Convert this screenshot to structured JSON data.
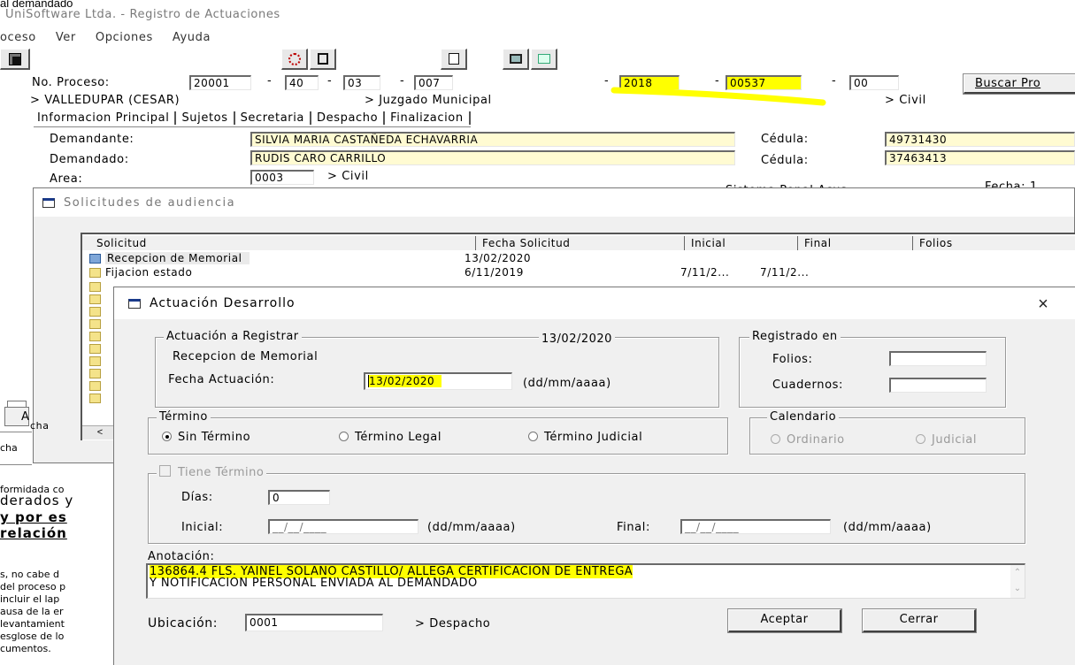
{
  "top_clip": "al demandado",
  "main_window": {
    "title": "UniSoftware Ltda. - Registro de Actuaciones",
    "menu": [
      "oceso",
      "Ver",
      "Opciones",
      "Ayuda"
    ],
    "no_proceso_label": "No. Proceso:",
    "proceso_parts": [
      "20001",
      "40",
      "03",
      "007",
      "2018",
      "00537",
      "00"
    ],
    "buscar_label": "Buscar Pro",
    "location_city": "> VALLEDUPAR (CESAR)",
    "location_court": "> Juzgado Municipal",
    "location_type": "> Civil",
    "tabs": [
      "Informacion Principal",
      "Sujetos",
      "Secretaria",
      "Despacho",
      "Finalizacion"
    ],
    "demandante_label": "Demandante:",
    "demandante": "SILVIA MARIA CASTAÑEDA ECHAVARRIA",
    "demandante_cedula_label": "Cédula:",
    "demandante_cedula": "49731430",
    "demandado_label": "Demandado:",
    "demandado": "RUDIS CARO CARRILLO",
    "demandado_cedula_label": "Cédula:",
    "demandado_cedula": "37463413",
    "area_label": "Area:",
    "area": "0003",
    "area_desc": "> Civil",
    "sistema_penal_clip": "Sistema Penal Acus",
    "fecha_clip": "Fecha:  1"
  },
  "left_clip_text": [
    "formidada co",
    "derados y",
    "y por es",
    "relación",
    "s, no cabe d",
    "del proceso p",
    " incluir el lap",
    "ausa de la er",
    "levantamient",
    "esglose de lo",
    "cumentos."
  ],
  "solicitudes": {
    "title": "Solicitudes de audiencia",
    "columns": [
      "Solicitud",
      "Fecha Solicitud",
      "Inicial",
      "Final",
      "Folios"
    ],
    "rows": [
      {
        "solicitud": "Recepcion de Memorial",
        "fecha": "13/02/2020",
        "inicial": "",
        "final": ""
      },
      {
        "solicitud": "Fijacion estado",
        "fecha": "6/11/2019",
        "inicial": "7/11/2...",
        "final": "7/11/2..."
      }
    ],
    "side_clip_a": "A",
    "side_clip_b": "cha"
  },
  "dialog": {
    "title": "Actuación Desarrollo",
    "actuacion_group": "Actuación a Registrar",
    "actuacion_date": "13/02/2020",
    "actuacion_name": "Recepcion de Memorial",
    "fecha_actuacion_label": "Fecha Actuación:",
    "fecha_actuacion_value": "13/02/2020",
    "fecha_format": "(dd/mm/aaaa)",
    "registrado_group": "Registrado en",
    "folios_label": "Folios:",
    "cuadernos_label": "Cuadernos:",
    "termino_group": "Término",
    "radio_sin": "Sin Término",
    "radio_legal": "Término Legal",
    "radio_judicial": "Término Judicial",
    "calendario_group": "Calendario",
    "radio_ordinario": "Ordinario",
    "radio_cal_judicial": "Judicial",
    "tiene_termino": "Tiene Término",
    "dias_label": "Días:",
    "dias_value": "0",
    "inicial_label": "Inicial:",
    "inicial_value": "__/__/____",
    "inicial_format": "(dd/mm/aaaa)",
    "final_label": "Final:",
    "final_value": "__/__/____",
    "final_format": "(dd/mm/aaaa)",
    "anotacion_label": "Anotación:",
    "anotacion_line1": "136864.4 FLS. YAINEL SOLANO CASTILLO/ ALLEGA CERTIFICACION DE ENTREGA",
    "anotacion_line2": "Y NOTIFICACION PERSONAL ENVIADA AL DEMANDADO",
    "ubicacion_label": "Ubicación:",
    "ubicacion_value": "0001",
    "ubicacion_desc": "> Despacho",
    "aceptar": "Aceptar",
    "cerrar": "Cerrar"
  },
  "colors": {
    "highlight": "#ffff00",
    "field_yellow": "#fffbd2",
    "window_bg": "#f0f0f0"
  }
}
